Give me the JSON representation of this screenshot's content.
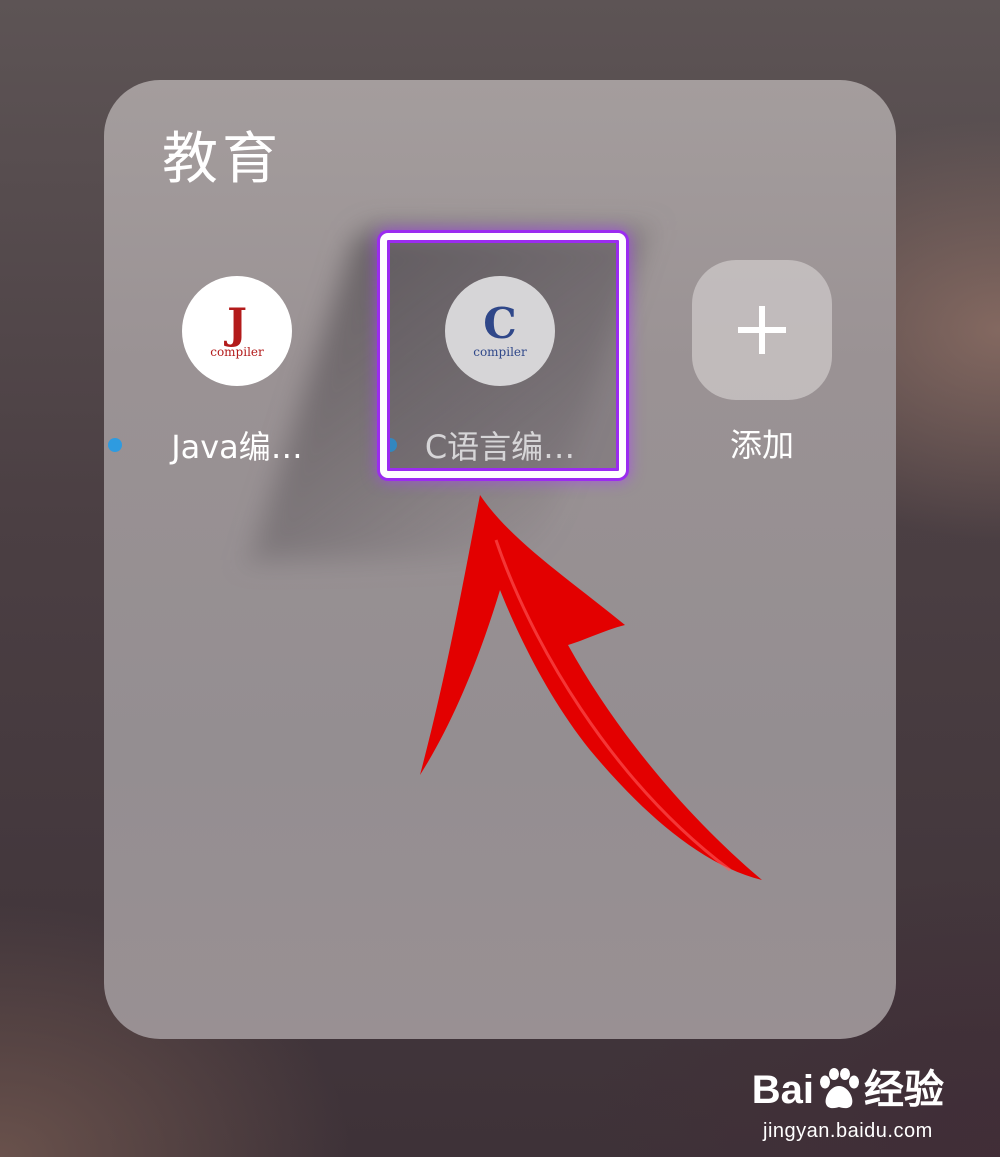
{
  "folder": {
    "title": "教育"
  },
  "apps": [
    {
      "label": "Java编…",
      "icon_letter": "J",
      "icon_sublabel": "compiler",
      "icon_color": "#b31b1b",
      "has_new_dot": true
    },
    {
      "label": "C语言编…",
      "icon_letter": "C",
      "icon_sublabel": "compiler",
      "icon_color": "#2a4a9c",
      "has_new_dot": true,
      "highlighted": true
    },
    {
      "label": "添加",
      "icon": "plus-icon"
    }
  ],
  "colors": {
    "highlight_border": "#ffffff",
    "highlight_glow": "#9b2cf0",
    "arrow": "#e30000",
    "new_dot": "#2e9be0"
  },
  "watermark": {
    "brand_prefix": "Bai",
    "brand_suffix": "经验",
    "url": "jingyan.baidu.com",
    "icon": "paw-icon"
  }
}
